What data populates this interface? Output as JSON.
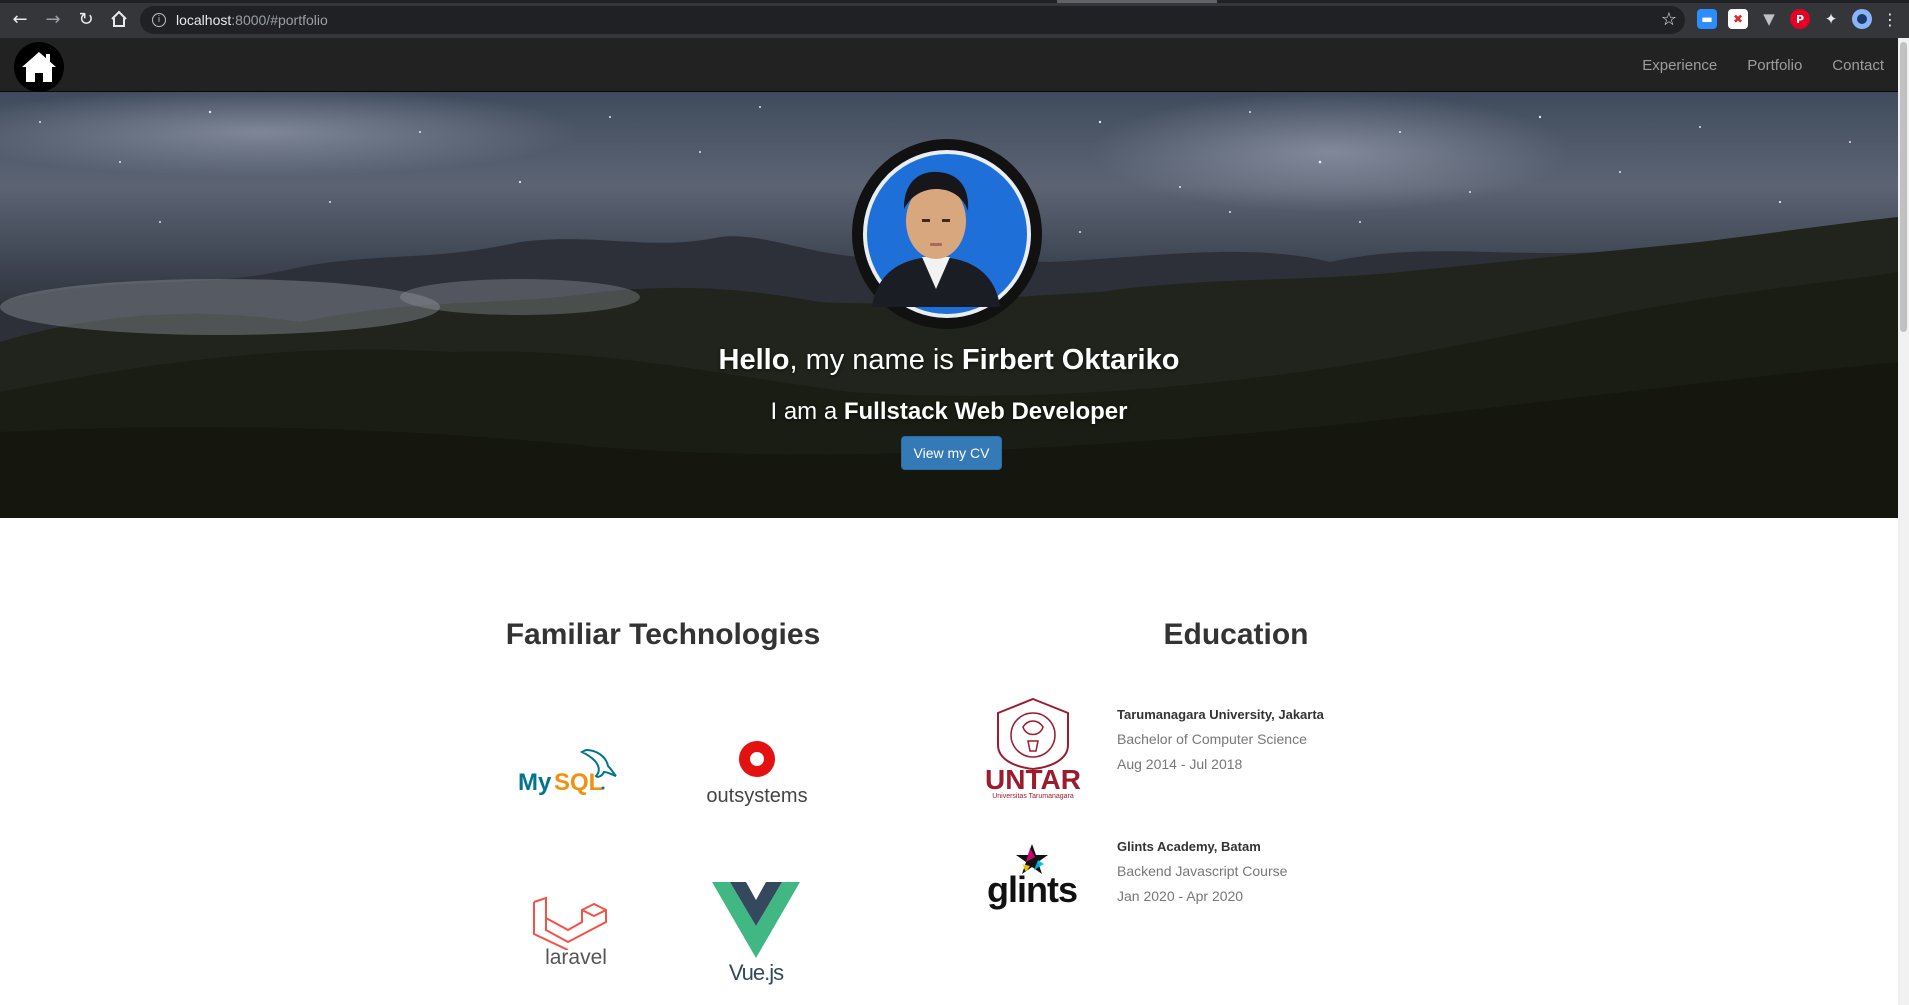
{
  "browser": {
    "url_host": "localhost",
    "url_rest": ":8000/#portfolio"
  },
  "navbar": {
    "logo_icon": "home-icon",
    "links": [
      "Experience",
      "Portfolio",
      "Contact"
    ]
  },
  "hero": {
    "greeting_hello": "Hello",
    "greeting_mid": ", my name is ",
    "name": "Firbert Oktariko",
    "role_prefix": "I am a ",
    "role": "Fullstack Web Developer",
    "cv_button": "View my CV"
  },
  "technologies": {
    "title": "Familiar Technologies",
    "items": [
      {
        "name": "MySQL",
        "label": "MySQL"
      },
      {
        "name": "outsystems",
        "label": "outsystems"
      },
      {
        "name": "laravel",
        "label": "laravel"
      },
      {
        "name": "Vue.js",
        "label": "Vue.js"
      }
    ]
  },
  "education": {
    "title": "Education",
    "items": [
      {
        "logo_label": "UNTAR",
        "logo_sub": "Universitas Tarumanagara",
        "school": "Tarumanagara University, Jakarta",
        "program": "Bachelor of Computer Science",
        "period": "Aug 2014 - Jul 2018"
      },
      {
        "logo_label": "glints",
        "school": "Glints Academy, Batam",
        "program": "Backend Javascript Course",
        "period": "Jan 2020 - Apr 2020"
      }
    ]
  },
  "colors": {
    "primary_button": "#337ab7",
    "navbar_bg": "#222222",
    "nav_link": "#9d9d9d",
    "mysql_blue": "#00758f",
    "mysql_orange": "#f29111",
    "outsystems_red": "#e3110f",
    "laravel_red": "#f55247",
    "vue_green": "#41b883",
    "vue_dark": "#35495e",
    "untar_red": "#9b1c2e"
  }
}
